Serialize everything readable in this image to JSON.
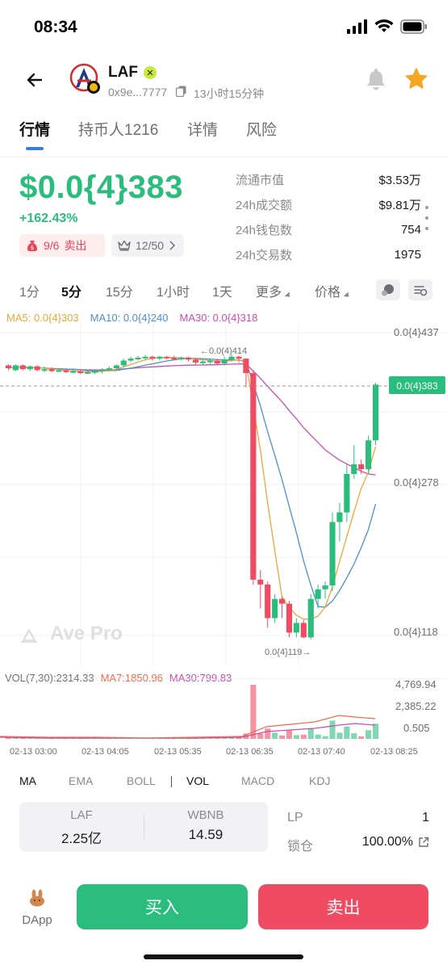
{
  "status_bar": {
    "time": "08:34"
  },
  "header": {
    "token_name": "LAF",
    "address": "0x9e...7777",
    "age": "13小时15分钟"
  },
  "tabs": [
    "行情",
    "持币人1216",
    "详情",
    "风险"
  ],
  "price": {
    "value": "$0.0{4}383",
    "change": "+162.43%",
    "buy_sell": "9/6",
    "sell_label": "卖出",
    "crown_count": "12/50"
  },
  "stats": [
    {
      "label": "流通市值",
      "value": "$3.53万"
    },
    {
      "label": "24h成交额",
      "value": "$9.81万"
    },
    {
      "label": "24h钱包数",
      "value": "754"
    },
    {
      "label": "24h交易数",
      "value": "1975"
    }
  ],
  "timeframes": [
    "1分",
    "5分",
    "15分",
    "1小时",
    "1天",
    "更多",
    "价格"
  ],
  "ma_legend": {
    "ma5": "MA5: 0.0{4}303",
    "ma10": "MA10: 0.0{4}240",
    "ma30": "MA30: 0.0{4}318"
  },
  "chart_data": {
    "type": "candlestick",
    "y_axis_labels": [
      "0.0{4}437",
      "0.0{4}278",
      "0.0{4}118"
    ],
    "current_price_label": "0.0(4)383",
    "high_marker": "←0.0(4)414",
    "low_marker": "0.0{4}119→",
    "watermark": "Ave Pro",
    "x_labels": [
      "02-13 03:00",
      "02-13 04:05",
      "02-13 05:35",
      "02-13 06:35",
      "02-13 07:40",
      "02-13 08:25"
    ],
    "candles": [
      [
        403,
        404,
        400,
        398
      ],
      [
        398,
        404,
        403,
        397
      ],
      [
        403,
        404,
        399,
        398
      ],
      [
        399,
        403,
        402,
        397
      ],
      [
        402,
        403,
        398,
        397
      ],
      [
        398,
        402,
        399,
        396
      ],
      [
        399,
        401,
        397,
        396
      ],
      [
        397,
        400,
        398,
        396
      ],
      [
        398,
        400,
        396,
        395
      ],
      [
        396,
        399,
        397,
        395
      ],
      [
        397,
        399,
        395,
        394
      ],
      [
        395,
        398,
        396,
        394
      ],
      [
        396,
        399,
        397,
        394
      ],
      [
        397,
        400,
        399,
        395
      ],
      [
        399,
        402,
        400,
        397
      ],
      [
        400,
        404,
        403,
        398
      ],
      [
        403,
        410,
        408,
        401
      ],
      [
        408,
        412,
        410,
        406
      ],
      [
        410,
        413,
        411,
        408
      ],
      [
        411,
        414,
        412,
        409
      ],
      [
        412,
        413,
        410,
        408
      ],
      [
        410,
        413,
        412,
        408
      ],
      [
        412,
        413,
        411,
        409
      ],
      [
        411,
        413,
        410,
        408
      ],
      [
        410,
        412,
        411,
        408
      ],
      [
        411,
        412,
        409,
        407
      ],
      [
        409,
        410,
        406,
        403
      ],
      [
        406,
        408,
        407,
        403
      ],
      [
        407,
        410,
        408,
        404
      ],
      [
        408,
        410,
        405,
        404
      ],
      [
        405,
        412,
        409,
        403
      ],
      [
        409,
        414,
        412,
        407
      ],
      [
        412,
        413,
        410,
        406
      ],
      [
        410,
        408,
        395,
        380
      ],
      [
        395,
        398,
        180,
        175
      ],
      [
        180,
        190,
        175,
        150
      ],
      [
        175,
        178,
        140,
        130
      ],
      [
        140,
        165,
        160,
        135
      ],
      [
        160,
        162,
        155,
        140
      ],
      [
        155,
        158,
        125,
        120
      ],
      [
        125,
        140,
        135,
        120
      ],
      [
        135,
        138,
        120,
        119
      ],
      [
        120,
        165,
        160,
        118
      ],
      [
        160,
        175,
        170,
        150
      ],
      [
        170,
        178,
        174,
        160
      ],
      [
        174,
        250,
        240,
        168
      ],
      [
        240,
        260,
        250,
        220
      ],
      [
        250,
        300,
        290,
        240
      ],
      [
        290,
        320,
        300,
        285
      ],
      [
        300,
        305,
        295,
        290
      ],
      [
        295,
        330,
        325,
        290
      ],
      [
        325,
        385,
        383,
        320
      ]
    ],
    "volume_labels": [
      "4,769.94",
      "2,385.22",
      "0.505"
    ],
    "volume_legend": {
      "vol": "VOL(7,30):2314.33",
      "ma7": "MA7:1850.96",
      "ma30": "MA30:799.83"
    }
  },
  "indicators": [
    "MA",
    "EMA",
    "BOLL",
    "VOL",
    "MACD",
    "KDJ"
  ],
  "pool": {
    "token_a": {
      "symbol": "LAF",
      "amount": "2.25亿"
    },
    "token_b": {
      "symbol": "WBNB",
      "amount": "14.59"
    },
    "lp_label": "LP",
    "lp_value": "1",
    "lock_label": "锁仓",
    "lock_value": "100.00%"
  },
  "bottom": {
    "dapp_label": "DApp",
    "buy_label": "买入",
    "sell_label": "卖出"
  },
  "colors": {
    "up": "#2bbd7e",
    "down": "#ef4b62",
    "accent": "#3b7ddd",
    "ma5": "#e5a93a",
    "ma10": "#4f8fc9",
    "ma30": "#c94fae"
  }
}
